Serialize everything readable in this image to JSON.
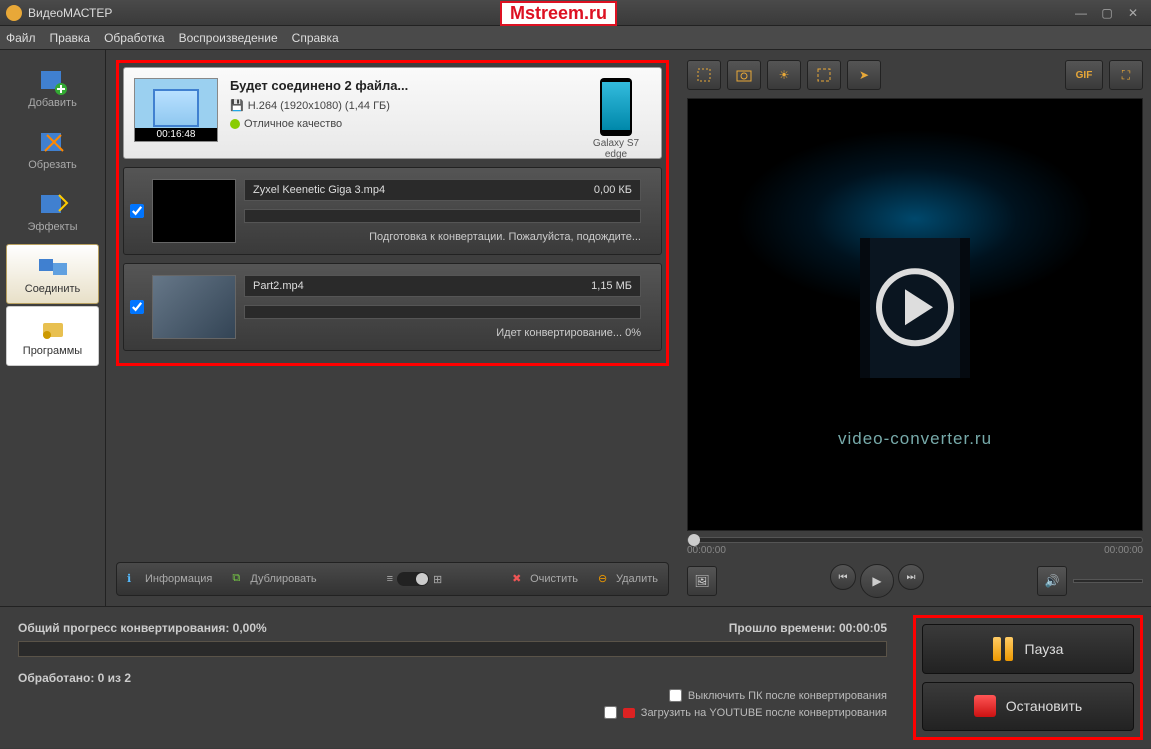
{
  "titlebar": {
    "title": "ВидеоМАСТЕР",
    "watermark": "Mstreem.ru"
  },
  "menu": {
    "file": "Файл",
    "edit": "Правка",
    "process": "Обработка",
    "playback": "Воспроизведение",
    "help": "Справка"
  },
  "sidebar": {
    "add": "Добавить",
    "cut": "Обрезать",
    "effects": "Эффекты",
    "join": "Соединить",
    "programs": "Программы"
  },
  "merge": {
    "title": "Будет соединено 2 файла...",
    "format": "H.264 (1920x1080) (1,44 ГБ)",
    "quality": "Отличное качество",
    "duration": "00:16:48",
    "device": "Galaxy S7 edge"
  },
  "files": [
    {
      "name": "Zyxel Keenetic Giga 3.mp4",
      "size": "0,00 КБ",
      "status": "Подготовка к конвертации. Пожалуйста, подождите..."
    },
    {
      "name": "Part2.mp4",
      "size": "1,15 МБ",
      "status": "Идет конвертирование... 0%"
    }
  ],
  "bottombar": {
    "info": "Информация",
    "dup": "Дублировать",
    "clear": "Очистить",
    "del": "Удалить"
  },
  "righttools": {
    "gif": "GIF"
  },
  "preview": {
    "brand": "video-converter.ru",
    "time_start": "00:00:00",
    "time_end": "00:00:00"
  },
  "footer": {
    "progress": "Общий прогресс конвертирования: 0,00%",
    "elapsed_label": "Прошло времени:",
    "elapsed": "00:00:05",
    "processed_label": "Обработано:",
    "processed": "0 из 2",
    "shutdown": "Выключить ПК после конвертирования",
    "youtube": "Загрузить на YOUTUBE после конвертирования",
    "pause": "Пауза",
    "stop": "Остановить"
  }
}
